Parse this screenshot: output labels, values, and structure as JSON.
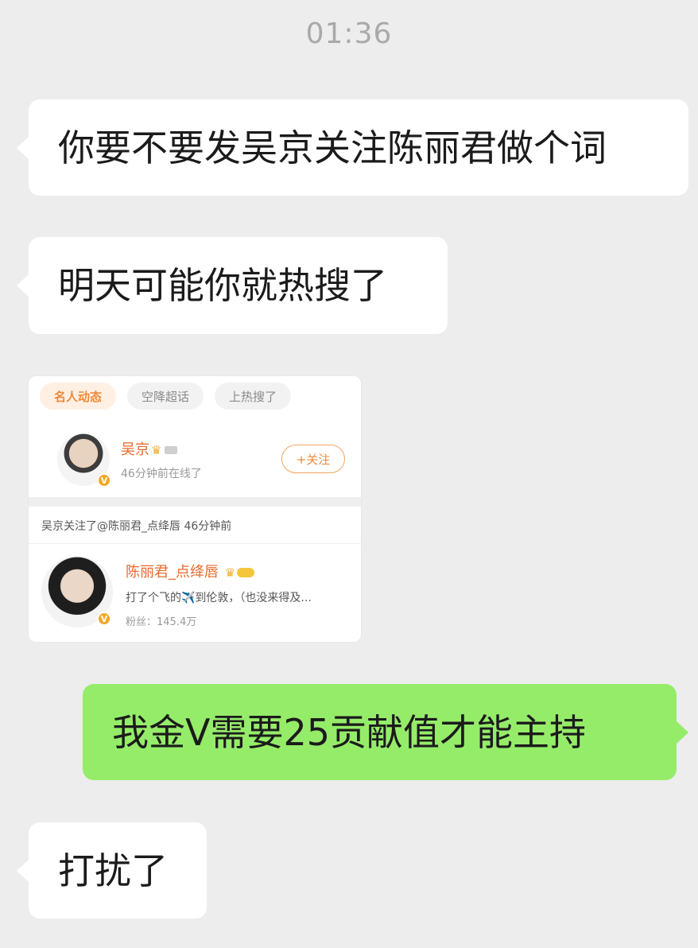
{
  "chat": {
    "timestamp": "01:36",
    "messages": [
      {
        "side": "incoming",
        "text": "你要不要发吴京关注陈丽君做个词"
      },
      {
        "side": "incoming",
        "text": "明天可能你就热搜了"
      },
      {
        "side": "outgoing",
        "text": "我金V需要25贡献值才能主持"
      },
      {
        "side": "incoming",
        "text": "打扰了"
      }
    ]
  },
  "weibo_card": {
    "tabs": [
      "名人动态",
      "空降超话",
      "上热搜了"
    ],
    "user1": {
      "name": "吴京",
      "status": "46分钟前在线了",
      "follow_label": "+关注",
      "badge": "V"
    },
    "activity_text": "吴京关注了@陈丽君_点绛唇 46分钟前",
    "user2": {
      "name": "陈丽君_点绛唇",
      "description": "打了个飞的✈️到伦敦，（也没来得及...",
      "fans": "粉丝：145.4万",
      "badge": "V"
    }
  },
  "colors": {
    "background": "#ededed",
    "incoming_bubble": "#ffffff",
    "outgoing_bubble": "#95ec69",
    "weibo_orange": "#f08a3a"
  }
}
